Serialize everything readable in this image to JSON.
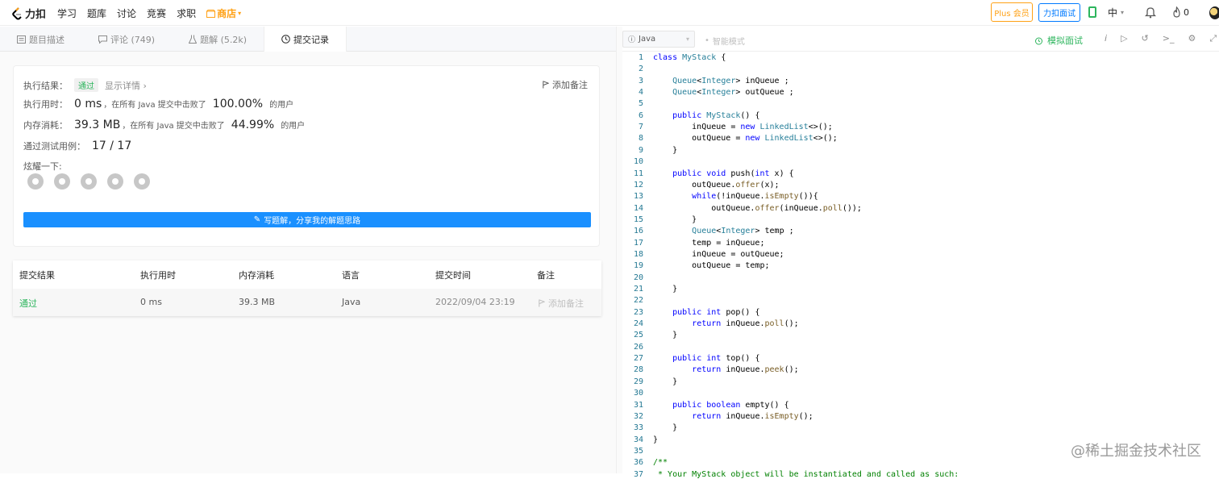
{
  "brand": {
    "name": "力扣"
  },
  "nav": {
    "items": [
      "学习",
      "题库",
      "讨论",
      "竞赛",
      "求职"
    ],
    "store": "商店"
  },
  "top_right": {
    "plus": "Plus 会员",
    "mock": "力扣面试",
    "lang": "中",
    "points": "0"
  },
  "tabs": [
    {
      "label": "题目描述",
      "icon": "doc-icon"
    },
    {
      "label": "评论 (749)",
      "icon": "comment-icon"
    },
    {
      "label": "题解 (5.2k)",
      "icon": "flask-icon"
    },
    {
      "label": "提交记录",
      "icon": "clock-icon"
    }
  ],
  "result": {
    "label": "执行结果：",
    "status": "通过",
    "detail": "显示详情 ›",
    "note": "添加备注",
    "time_label": "执行用时：",
    "time_value": "0 ms",
    "time_mid": "，在所有 Java 提交中击败了",
    "time_pct": "100.00%",
    "users": "的用户",
    "mem_label": "内存消耗：",
    "mem_value": "39.3 MB",
    "mem_mid": "，在所有 Java 提交中击败了",
    "mem_pct": "44.99%",
    "tests_label": "通过测试用例：",
    "tests_value": "17 / 17",
    "share_label": "炫耀一下:",
    "write_btn": "写题解，分享我的解题思路"
  },
  "table": {
    "headers": [
      "提交结果",
      "执行用时",
      "内存消耗",
      "语言",
      "提交时间",
      "备注"
    ],
    "rows": [
      [
        "通过",
        "0 ms",
        "39.3 MB",
        "Java",
        "2022/09/04 23:19",
        "添加备注"
      ]
    ]
  },
  "editor": {
    "language": "Java",
    "smart_mode": "智能模式",
    "mock": "模拟面试"
  },
  "code_lines": [
    "class MyStack {",
    "",
    "    Queue<Integer> inQueue ;",
    "    Queue<Integer> outQueue ;",
    "",
    "    public MyStack() {",
    "        inQueue = new LinkedList<>();",
    "        outQueue = new LinkedList<>();",
    "    }",
    "",
    "    public void push(int x) {",
    "        outQueue.offer(x);",
    "        while(!inQueue.isEmpty()){",
    "            outQueue.offer(inQueue.poll());",
    "        }",
    "        Queue<Integer> temp ;",
    "        temp = inQueue;",
    "        inQueue = outQueue;",
    "        outQueue = temp;",
    "",
    "    }",
    "",
    "    public int pop() {",
    "        return inQueue.poll();",
    "    }",
    "",
    "    public int top() {",
    "        return inQueue.peek();",
    "    }",
    "",
    "    public boolean empty() {",
    "        return inQueue.isEmpty();",
    "    }",
    "}",
    "",
    "/**",
    " * Your MyStack object will be instantiated and called as such:"
  ],
  "watermark": "@稀土掘金技术社区"
}
